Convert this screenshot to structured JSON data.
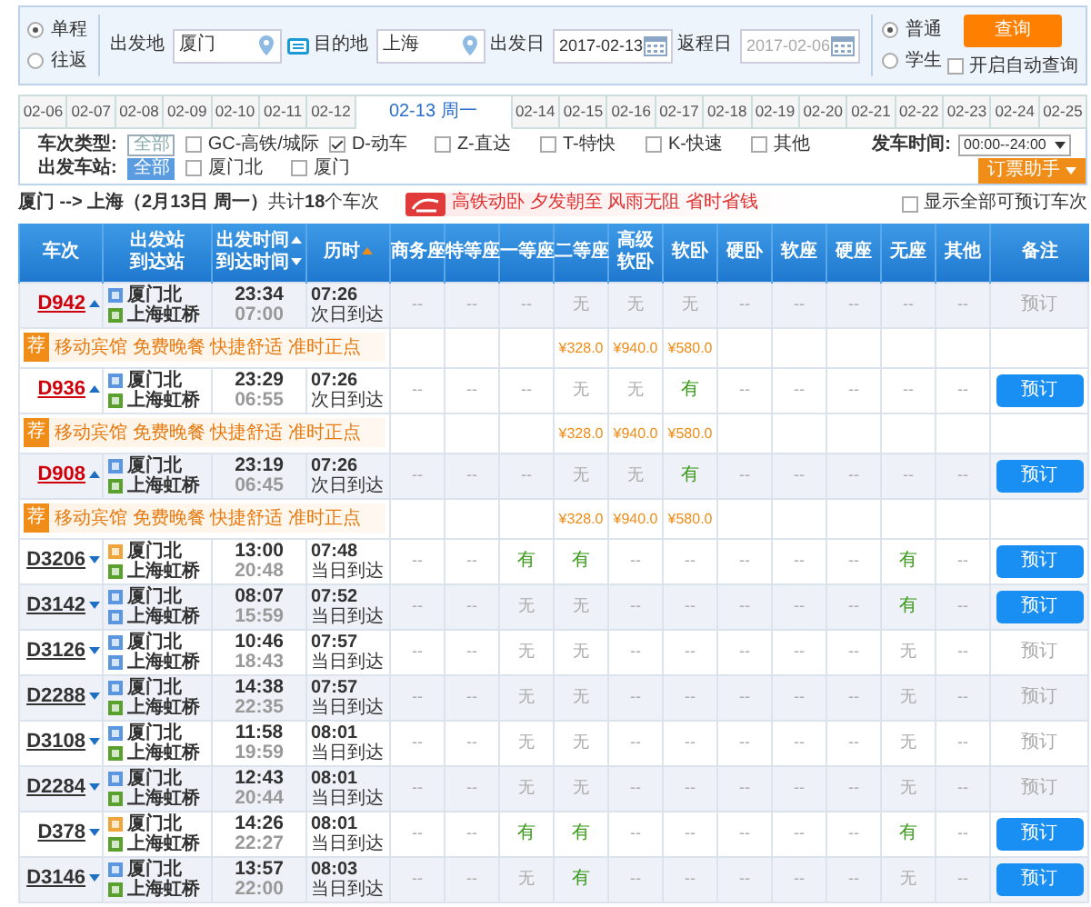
{
  "trip_type": [
    {
      "label": "单程",
      "selected": true
    },
    {
      "label": "往返",
      "selected": false
    }
  ],
  "from": {
    "label": "出发地",
    "value": "厦门"
  },
  "to": {
    "label": "目的地",
    "value": "上海"
  },
  "depart_date": {
    "label": "出发日",
    "value": "2017-02-13"
  },
  "return_date": {
    "label": "返程日",
    "value": "2017-02-06",
    "disabled": true
  },
  "passenger_type": [
    {
      "label": "普通",
      "selected": true
    },
    {
      "label": "学生",
      "selected": false
    }
  ],
  "query_button": "查询",
  "auto_query": {
    "label": "开启自动查询",
    "checked": false
  },
  "date_tabs": [
    {
      "label": "02-06",
      "selected": false
    },
    {
      "label": "02-07",
      "selected": false
    },
    {
      "label": "02-08",
      "selected": false
    },
    {
      "label": "02-09",
      "selected": false
    },
    {
      "label": "02-10",
      "selected": false
    },
    {
      "label": "02-11",
      "selected": false
    },
    {
      "label": "02-12",
      "selected": false
    },
    {
      "label": "02-13 周一",
      "selected": true
    },
    {
      "label": "02-14",
      "selected": false
    },
    {
      "label": "02-15",
      "selected": false
    },
    {
      "label": "02-16",
      "selected": false
    },
    {
      "label": "02-17",
      "selected": false
    },
    {
      "label": "02-18",
      "selected": false
    },
    {
      "label": "02-19",
      "selected": false
    },
    {
      "label": "02-20",
      "selected": false
    },
    {
      "label": "02-21",
      "selected": false
    },
    {
      "label": "02-22",
      "selected": false
    },
    {
      "label": "02-23",
      "selected": false
    },
    {
      "label": "02-24",
      "selected": false
    },
    {
      "label": "02-25",
      "selected": false
    }
  ],
  "filters": {
    "train_type": {
      "label": "车次类型:",
      "all": {
        "label": "全部",
        "selected": false
      },
      "options": [
        {
          "label": "GC-高铁/城际",
          "checked": false
        },
        {
          "label": "D-动车",
          "checked": true
        },
        {
          "label": "Z-直达",
          "checked": false
        },
        {
          "label": "T-特快",
          "checked": false
        },
        {
          "label": "K-快速",
          "checked": false
        },
        {
          "label": "其他",
          "checked": false
        }
      ]
    },
    "depart_time": {
      "label": "发车时间:",
      "value": "00:00--24:00"
    },
    "depart_station": {
      "label": "出发车站:",
      "all": {
        "label": "全部",
        "selected": true
      },
      "options": [
        {
          "label": "厦门北",
          "checked": false
        },
        {
          "label": "厦门",
          "checked": false
        }
      ]
    },
    "helper_button": "订票助手"
  },
  "summary": "**厦门 --> 上海（2月13日  周一）**共计**18**个车次",
  "banner": "高铁动卧 夕发朝至 风雨无阻 省时省钱",
  "show_all": {
    "label": "显示全部可预订车次",
    "checked": false
  },
  "table": {
    "columns": [
      {
        "lines": [
          "车次"
        ]
      },
      {
        "lines": [
          "出发站",
          "到达站"
        ]
      },
      {
        "lines": [
          "出发时间",
          "到达时间"
        ],
        "sortable": true,
        "sorted": false
      },
      {
        "lines": [
          "历时"
        ],
        "sortable": true,
        "sorted": true
      },
      {
        "lines": [
          "商务座"
        ]
      },
      {
        "lines": [
          "特等座"
        ]
      },
      {
        "lines": [
          "一等座"
        ]
      },
      {
        "lines": [
          "二等座"
        ]
      },
      {
        "lines": [
          "高级",
          "软卧"
        ]
      },
      {
        "lines": [
          "软卧"
        ]
      },
      {
        "lines": [
          "硬卧"
        ]
      },
      {
        "lines": [
          "软座"
        ]
      },
      {
        "lines": [
          "硬座"
        ]
      },
      {
        "lines": [
          "无座"
        ]
      },
      {
        "lines": [
          "其他"
        ]
      },
      {
        "lines": [
          "备注"
        ]
      }
    ],
    "rows": [
      {
        "train": "D942",
        "highlighted": true,
        "expanded": true,
        "from": {
          "name": "厦门北",
          "kind": "pass"
        },
        "to": {
          "name": "上海虹桥",
          "kind": "end"
        },
        "depart": "23:34",
        "arrive": "07:00",
        "duration": "07:26",
        "arrival_day": "次日到达",
        "seats": [
          {
            "text": "--",
            "available": false
          },
          {
            "text": "--",
            "available": false
          },
          {
            "text": "--",
            "available": false
          },
          {
            "text": "无",
            "available": false,
            "price": "¥328.0"
          },
          {
            "text": "无",
            "available": false,
            "price": "¥940.0"
          },
          {
            "text": "无",
            "available": false,
            "price": "¥580.0"
          },
          {
            "text": "--",
            "available": false
          },
          {
            "text": "--",
            "available": false
          },
          {
            "text": "--",
            "available": false
          },
          {
            "text": "--",
            "available": false
          },
          {
            "text": "--",
            "available": false
          }
        ],
        "book": {
          "label": "预订",
          "enabled": false
        },
        "promo": {
          "badge": "荐",
          "text": "移动宾馆 免费晚餐 快捷舒适 准时正点"
        }
      },
      {
        "train": "D936",
        "highlighted": true,
        "expanded": true,
        "from": {
          "name": "厦门北",
          "kind": "pass"
        },
        "to": {
          "name": "上海虹桥",
          "kind": "end"
        },
        "depart": "23:29",
        "arrive": "06:55",
        "duration": "07:26",
        "arrival_day": "次日到达",
        "seats": [
          {
            "text": "--",
            "available": false
          },
          {
            "text": "--",
            "available": false
          },
          {
            "text": "--",
            "available": false
          },
          {
            "text": "无",
            "available": false,
            "price": "¥328.0"
          },
          {
            "text": "无",
            "available": false,
            "price": "¥940.0"
          },
          {
            "text": "有",
            "available": true,
            "price": "¥580.0"
          },
          {
            "text": "--",
            "available": false
          },
          {
            "text": "--",
            "available": false
          },
          {
            "text": "--",
            "available": false
          },
          {
            "text": "--",
            "available": false
          },
          {
            "text": "--",
            "available": false
          }
        ],
        "book": {
          "label": "预订",
          "enabled": true
        },
        "promo": {
          "badge": "荐",
          "text": "移动宾馆 免费晚餐 快捷舒适 准时正点"
        }
      },
      {
        "train": "D908",
        "highlighted": true,
        "expanded": true,
        "from": {
          "name": "厦门北",
          "kind": "pass"
        },
        "to": {
          "name": "上海虹桥",
          "kind": "end"
        },
        "depart": "23:19",
        "arrive": "06:45",
        "duration": "07:26",
        "arrival_day": "次日到达",
        "seats": [
          {
            "text": "--",
            "available": false
          },
          {
            "text": "--",
            "available": false
          },
          {
            "text": "--",
            "available": false
          },
          {
            "text": "无",
            "available": false,
            "price": "¥328.0"
          },
          {
            "text": "无",
            "available": false,
            "price": "¥940.0"
          },
          {
            "text": "有",
            "available": true,
            "price": "¥580.0"
          },
          {
            "text": "--",
            "available": false
          },
          {
            "text": "--",
            "available": false
          },
          {
            "text": "--",
            "available": false
          },
          {
            "text": "--",
            "available": false
          },
          {
            "text": "--",
            "available": false
          }
        ],
        "book": {
          "label": "预订",
          "enabled": true
        },
        "promo": {
          "badge": "荐",
          "text": "移动宾馆 免费晚餐 快捷舒适 准时正点"
        }
      },
      {
        "train": "D3206",
        "highlighted": false,
        "expanded": false,
        "from": {
          "name": "厦门北",
          "kind": "start"
        },
        "to": {
          "name": "上海虹桥",
          "kind": "end"
        },
        "depart": "13:00",
        "arrive": "20:48",
        "duration": "07:48",
        "arrival_day": "当日到达",
        "seats": [
          {
            "text": "--",
            "available": false
          },
          {
            "text": "--",
            "available": false
          },
          {
            "text": "有",
            "available": true
          },
          {
            "text": "有",
            "available": true
          },
          {
            "text": "--",
            "available": false
          },
          {
            "text": "--",
            "available": false
          },
          {
            "text": "--",
            "available": false
          },
          {
            "text": "--",
            "available": false
          },
          {
            "text": "--",
            "available": false
          },
          {
            "text": "有",
            "available": true
          },
          {
            "text": "--",
            "available": false
          }
        ],
        "book": {
          "label": "预订",
          "enabled": true
        }
      },
      {
        "train": "D3142",
        "highlighted": false,
        "expanded": false,
        "from": {
          "name": "厦门北",
          "kind": "pass"
        },
        "to": {
          "name": "上海虹桥",
          "kind": "pass"
        },
        "depart": "08:07",
        "arrive": "15:59",
        "duration": "07:52",
        "arrival_day": "当日到达",
        "seats": [
          {
            "text": "--",
            "available": false
          },
          {
            "text": "--",
            "available": false
          },
          {
            "text": "无",
            "available": false
          },
          {
            "text": "无",
            "available": false
          },
          {
            "text": "--",
            "available": false
          },
          {
            "text": "--",
            "available": false
          },
          {
            "text": "--",
            "available": false
          },
          {
            "text": "--",
            "available": false
          },
          {
            "text": "--",
            "available": false
          },
          {
            "text": "有",
            "available": true
          },
          {
            "text": "--",
            "available": false
          }
        ],
        "book": {
          "label": "预订",
          "enabled": true
        }
      },
      {
        "train": "D3126",
        "highlighted": false,
        "expanded": false,
        "from": {
          "name": "厦门北",
          "kind": "pass"
        },
        "to": {
          "name": "上海虹桥",
          "kind": "pass"
        },
        "depart": "10:46",
        "arrive": "18:43",
        "duration": "07:57",
        "arrival_day": "当日到达",
        "seats": [
          {
            "text": "--",
            "available": false
          },
          {
            "text": "--",
            "available": false
          },
          {
            "text": "无",
            "available": false
          },
          {
            "text": "无",
            "available": false
          },
          {
            "text": "--",
            "available": false
          },
          {
            "text": "--",
            "available": false
          },
          {
            "text": "--",
            "available": false
          },
          {
            "text": "--",
            "available": false
          },
          {
            "text": "--",
            "available": false
          },
          {
            "text": "无",
            "available": false
          },
          {
            "text": "--",
            "available": false
          }
        ],
        "book": {
          "label": "预订",
          "enabled": false
        }
      },
      {
        "train": "D2288",
        "highlighted": false,
        "expanded": false,
        "from": {
          "name": "厦门北",
          "kind": "pass"
        },
        "to": {
          "name": "上海虹桥",
          "kind": "end"
        },
        "depart": "14:38",
        "arrive": "22:35",
        "duration": "07:57",
        "arrival_day": "当日到达",
        "seats": [
          {
            "text": "--",
            "available": false
          },
          {
            "text": "--",
            "available": false
          },
          {
            "text": "无",
            "available": false
          },
          {
            "text": "无",
            "available": false
          },
          {
            "text": "--",
            "available": false
          },
          {
            "text": "--",
            "available": false
          },
          {
            "text": "--",
            "available": false
          },
          {
            "text": "--",
            "available": false
          },
          {
            "text": "--",
            "available": false
          },
          {
            "text": "无",
            "available": false
          },
          {
            "text": "--",
            "available": false
          }
        ],
        "book": {
          "label": "预订",
          "enabled": false
        }
      },
      {
        "train": "D3108",
        "highlighted": false,
        "expanded": false,
        "from": {
          "name": "厦门北",
          "kind": "pass"
        },
        "to": {
          "name": "上海虹桥",
          "kind": "end"
        },
        "depart": "11:58",
        "arrive": "19:59",
        "duration": "08:01",
        "arrival_day": "当日到达",
        "seats": [
          {
            "text": "--",
            "available": false
          },
          {
            "text": "--",
            "available": false
          },
          {
            "text": "无",
            "available": false
          },
          {
            "text": "无",
            "available": false
          },
          {
            "text": "--",
            "available": false
          },
          {
            "text": "--",
            "available": false
          },
          {
            "text": "--",
            "available": false
          },
          {
            "text": "--",
            "available": false
          },
          {
            "text": "--",
            "available": false
          },
          {
            "text": "无",
            "available": false
          },
          {
            "text": "--",
            "available": false
          }
        ],
        "book": {
          "label": "预订",
          "enabled": false
        }
      },
      {
        "train": "D2284",
        "highlighted": false,
        "expanded": false,
        "from": {
          "name": "厦门北",
          "kind": "pass"
        },
        "to": {
          "name": "上海虹桥",
          "kind": "end"
        },
        "depart": "12:43",
        "arrive": "20:44",
        "duration": "08:01",
        "arrival_day": "当日到达",
        "seats": [
          {
            "text": "--",
            "available": false
          },
          {
            "text": "--",
            "available": false
          },
          {
            "text": "无",
            "available": false
          },
          {
            "text": "无",
            "available": false
          },
          {
            "text": "--",
            "available": false
          },
          {
            "text": "--",
            "available": false
          },
          {
            "text": "--",
            "available": false
          },
          {
            "text": "--",
            "available": false
          },
          {
            "text": "--",
            "available": false
          },
          {
            "text": "无",
            "available": false
          },
          {
            "text": "--",
            "available": false
          }
        ],
        "book": {
          "label": "预订",
          "enabled": false
        }
      },
      {
        "train": "D378",
        "highlighted": false,
        "expanded": false,
        "from": {
          "name": "厦门北",
          "kind": "start"
        },
        "to": {
          "name": "上海虹桥",
          "kind": "end"
        },
        "depart": "14:26",
        "arrive": "22:27",
        "duration": "08:01",
        "arrival_day": "当日到达",
        "seats": [
          {
            "text": "--",
            "available": false
          },
          {
            "text": "--",
            "available": false
          },
          {
            "text": "有",
            "available": true
          },
          {
            "text": "有",
            "available": true
          },
          {
            "text": "--",
            "available": false
          },
          {
            "text": "--",
            "available": false
          },
          {
            "text": "--",
            "available": false
          },
          {
            "text": "--",
            "available": false
          },
          {
            "text": "--",
            "available": false
          },
          {
            "text": "有",
            "available": true
          },
          {
            "text": "--",
            "available": false
          }
        ],
        "book": {
          "label": "预订",
          "enabled": true
        }
      },
      {
        "train": "D3146",
        "highlighted": false,
        "expanded": false,
        "from": {
          "name": "厦门北",
          "kind": "pass"
        },
        "to": {
          "name": "上海虹桥",
          "kind": "end"
        },
        "depart": "13:57",
        "arrive": "22:00",
        "duration": "08:03",
        "arrival_day": "当日到达",
        "seats": [
          {
            "text": "--",
            "available": false
          },
          {
            "text": "--",
            "available": false
          },
          {
            "text": "无",
            "available": false
          },
          {
            "text": "有",
            "available": true
          },
          {
            "text": "--",
            "available": false
          },
          {
            "text": "--",
            "available": false
          },
          {
            "text": "--",
            "available": false
          },
          {
            "text": "--",
            "available": false
          },
          {
            "text": "--",
            "available": false
          },
          {
            "text": "无",
            "available": false
          },
          {
            "text": "--",
            "available": false
          }
        ],
        "book": {
          "label": "预订",
          "enabled": true
        }
      }
    ]
  }
}
